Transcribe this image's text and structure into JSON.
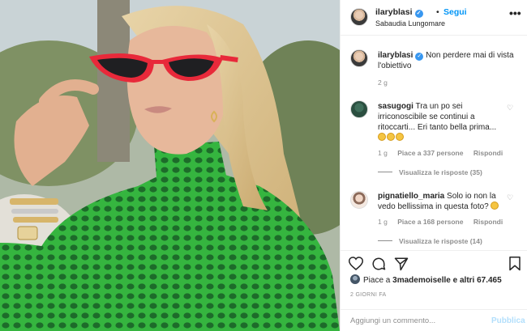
{
  "post": {
    "username": "ilaryblasi",
    "follow_label": "Segui",
    "separator": "•",
    "location": "Sabaudia Lungomare",
    "more_label": "•••",
    "caption": {
      "username": "ilaryblasi",
      "text": "Non perdere mai di vista l'obiettivo",
      "time": "2 g"
    },
    "comments": [
      {
        "username": "sasugogi",
        "text": "Tra un po sei irriconoscibile se continui a ritoccarti... Eri tanto bella prima...",
        "time": "1 g",
        "likes": "Piace a 337 persone",
        "reply_label": "Rispondi",
        "replies": "Visualizza le risposte (35)"
      },
      {
        "username": "pignatiello_maria",
        "text": "Solo io non la vedo bellissima in questa foto?",
        "time": "1 g",
        "likes": "Piace a 168 persone",
        "reply_label": "Rispondi",
        "replies": "Visualizza le risposte (14)"
      }
    ],
    "likes_summary": {
      "prefix": "Piace a ",
      "user": "3mademoiselle",
      "suffix": " e altri 67.465"
    },
    "date": "2 GIORNI FA",
    "comment_placeholder": "Aggiungi un commento...",
    "publish_label": "Pubblica"
  },
  "colors": {
    "link_blue": "#0095f6",
    "publish_disabled": "#b2dffc",
    "secondary_text": "#8e8e8e",
    "sweater_green": "#3fc24a",
    "sunglasses_red": "#e8293a"
  },
  "icons": [
    "verified-badge-icon",
    "more-options-icon",
    "heart-icon",
    "comment-icon",
    "share-icon",
    "bookmark-icon",
    "emoji-icon"
  ]
}
